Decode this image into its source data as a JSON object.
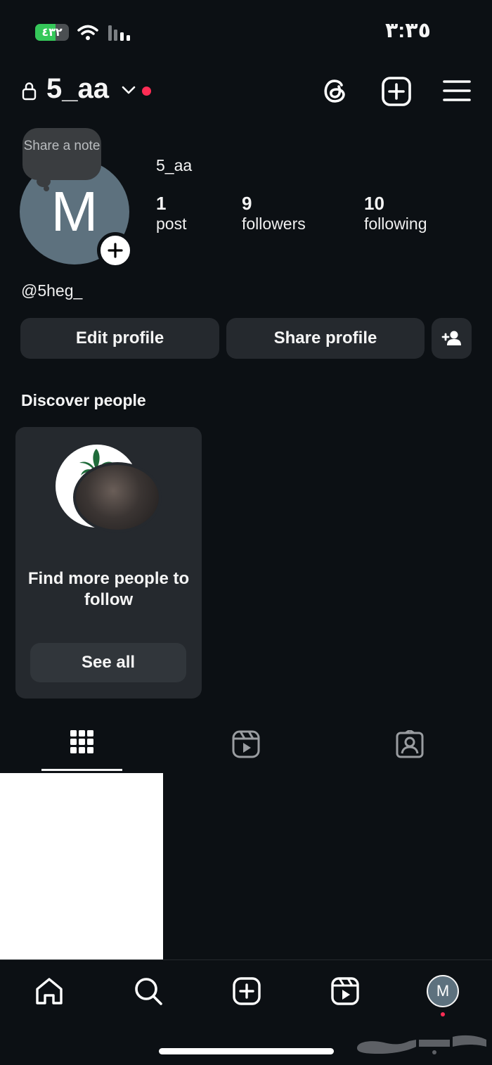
{
  "status_bar": {
    "time": "٣:٣٥",
    "battery": "٤٣٢"
  },
  "header": {
    "username": "5_aa",
    "icons": [
      "lock-icon",
      "chevron-down-icon",
      "threads-icon",
      "add-post-icon",
      "menu-icon"
    ]
  },
  "profile": {
    "note_prompt": "Share a note",
    "avatar_letter": "M",
    "display_name": "5_aa",
    "handle": "@5heg_",
    "stats": [
      {
        "value": "1",
        "label": "post"
      },
      {
        "value": "9",
        "label": "followers"
      },
      {
        "value": "10",
        "label": "following"
      }
    ]
  },
  "actions": {
    "edit": "Edit profile",
    "share": "Share profile",
    "add_user_icon": "add-user-icon"
  },
  "discover": {
    "title": "Discover people",
    "card_text": "Find more people to follow",
    "see_all": "See all"
  },
  "tabs": [
    "grid-icon",
    "reels-icon",
    "tagged-icon"
  ],
  "bottom_nav": {
    "items": [
      "home-icon",
      "search-icon",
      "create-icon",
      "reels-icon"
    ],
    "profile_letter": "M"
  },
  "colors": {
    "background": "#0c1014",
    "button": "#25292e",
    "accent_dot": "#ff2d55",
    "avatar": "#5d717e",
    "battery": "#35c759"
  }
}
